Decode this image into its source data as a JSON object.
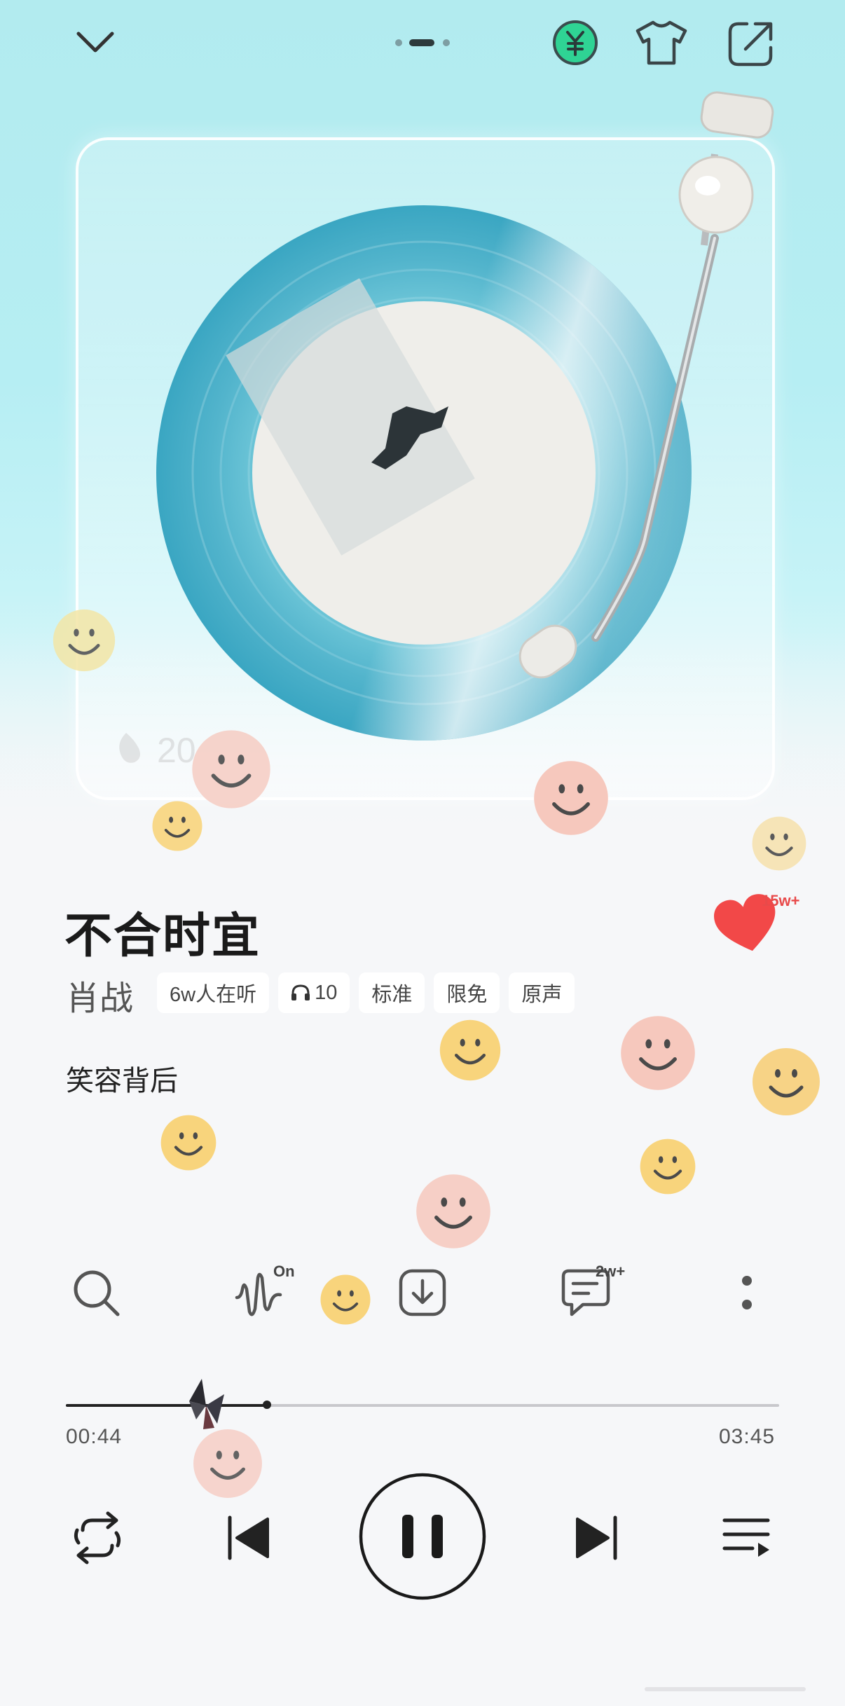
{
  "top_bar": {
    "collapse_icon": "chevron-down-icon",
    "vip_icon": "yuan-coin-icon",
    "skin_icon": "tshirt-icon",
    "share_icon": "share-icon"
  },
  "player": {
    "song_title": "不合时宜",
    "artist": "肖战",
    "chips": [
      {
        "label": "6w人在听"
      },
      {
        "label": "10",
        "icon": "headphones-icon"
      },
      {
        "label": "标准"
      },
      {
        "label": "限免"
      },
      {
        "label": "原声"
      }
    ],
    "like_count": "15w+",
    "lyric_line": "笑容背后",
    "watermark": "20"
  },
  "actions": {
    "search_icon": "search-icon",
    "sound_effect_badge": "On",
    "download_icon": "download-icon",
    "comment_badge": "2w+",
    "more_icon": "more-vertical-icon"
  },
  "progress": {
    "elapsed": "00:44",
    "duration": "03:45",
    "fraction": 0.282
  },
  "controls": {
    "repeat_icon": "repeat-icon",
    "prev_icon": "previous-icon",
    "pause_icon": "pause-icon",
    "next_icon": "next-icon",
    "playlist_icon": "playlist-icon"
  },
  "colors": {
    "accent_green": "#21c28a",
    "heart_red": "#f24848",
    "record_blue": "#4fb6cf"
  }
}
